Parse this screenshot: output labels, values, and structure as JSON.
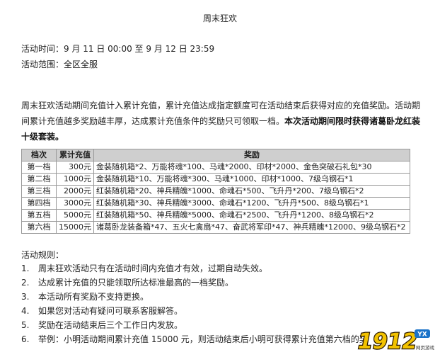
{
  "title": "周末狂欢",
  "event_time": "活动时间：9 月 11 日 00:00 至 9 月 12 日 23:59",
  "event_scope": "活动范围：全区全服",
  "intro": {
    "text": "周末狂欢活动期间充值计入累计充值，累计充值达成指定额度可在活动结束后获得对应的充值奖励。活动期间累计充值越多奖励越丰厚，达成累计充值条件的奖励只可领取一档。",
    "highlight": "本次活动期间限时获得诸葛卧龙红装十级套装。"
  },
  "table": {
    "headers": [
      "档次",
      "累计充值",
      "奖励"
    ],
    "rows": [
      [
        "第一档",
        "300元",
        "金装随机箱*2、万能将魂*100、马魂*2000、印材*2000、金色突破石礼包*30"
      ],
      [
        "第二档",
        "1000元",
        "金装随机箱*10、万能将魂*300、马魂*1000、印材*1000、7级乌钢石*1"
      ],
      [
        "第三档",
        "2000元",
        "红装随机箱*20、神兵精魄*1000、命魂石*500、飞升丹*200、7级乌钢石*2"
      ],
      [
        "第四档",
        "3000元",
        "红装随机箱*30、神兵精魄*3000、命魂石*1200、飞升丹*500、8级乌钢石*1"
      ],
      [
        "第五档",
        "5000元",
        "红装随机箱*50、神兵精魄*5000、命魂石*2500、飞升丹*1200、8级乌钢石*2"
      ],
      [
        "第六档",
        "15000元",
        "诸葛卧龙装备箱*47、五火七禽扇*47、奋武将军印*47、神兵精魄*12000、9级乌钢石*2"
      ]
    ]
  },
  "rules": {
    "title": "活动规则：",
    "items": [
      {
        "num": "1.",
        "text": "周末狂欢活动只有在活动时间内充值才有效，过期自动失效。"
      },
      {
        "num": "2.",
        "text": "达成累计充值的只能领取所达标准最高的一档奖励。"
      },
      {
        "num": "3.",
        "text": "本活动所有奖励不支持更换。"
      },
      {
        "num": "4.",
        "text": "如果您对活动有疑问可联系客服解答。"
      },
      {
        "num": "5.",
        "text": "奖励在活动结束后三个工作日内发放。"
      },
      {
        "num": "6.",
        "text": "举例：小明活动期间累计充值 15000 元，则活动结束后小明可获得累计充值第六档的奖"
      }
    ]
  },
  "watermark": {
    "text": "1912",
    "badge": "YX",
    "sub": "网页游戏",
    "colors": {
      "fill": "#f2c200",
      "stroke": "#2b1a00",
      "badge": "#1a73c9"
    }
  }
}
